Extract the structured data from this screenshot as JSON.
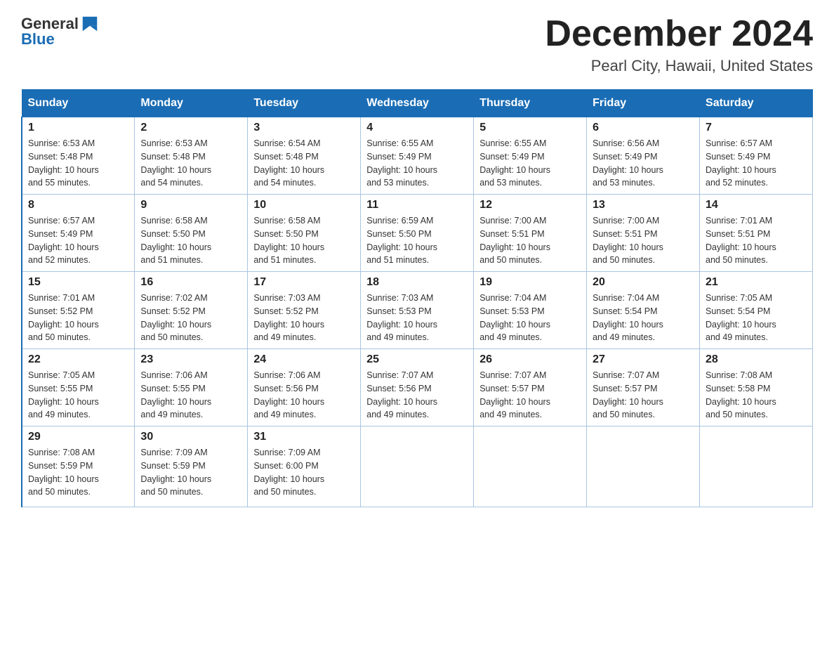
{
  "header": {
    "logo_general": "General",
    "logo_blue": "Blue",
    "month_title": "December 2024",
    "location": "Pearl City, Hawaii, United States"
  },
  "days_of_week": [
    "Sunday",
    "Monday",
    "Tuesday",
    "Wednesday",
    "Thursday",
    "Friday",
    "Saturday"
  ],
  "weeks": [
    [
      {
        "day": "1",
        "sunrise": "6:53 AM",
        "sunset": "5:48 PM",
        "daylight": "10 hours and 55 minutes."
      },
      {
        "day": "2",
        "sunrise": "6:53 AM",
        "sunset": "5:48 PM",
        "daylight": "10 hours and 54 minutes."
      },
      {
        "day": "3",
        "sunrise": "6:54 AM",
        "sunset": "5:48 PM",
        "daylight": "10 hours and 54 minutes."
      },
      {
        "day": "4",
        "sunrise": "6:55 AM",
        "sunset": "5:49 PM",
        "daylight": "10 hours and 53 minutes."
      },
      {
        "day": "5",
        "sunrise": "6:55 AM",
        "sunset": "5:49 PM",
        "daylight": "10 hours and 53 minutes."
      },
      {
        "day": "6",
        "sunrise": "6:56 AM",
        "sunset": "5:49 PM",
        "daylight": "10 hours and 53 minutes."
      },
      {
        "day": "7",
        "sunrise": "6:57 AM",
        "sunset": "5:49 PM",
        "daylight": "10 hours and 52 minutes."
      }
    ],
    [
      {
        "day": "8",
        "sunrise": "6:57 AM",
        "sunset": "5:49 PM",
        "daylight": "10 hours and 52 minutes."
      },
      {
        "day": "9",
        "sunrise": "6:58 AM",
        "sunset": "5:50 PM",
        "daylight": "10 hours and 51 minutes."
      },
      {
        "day": "10",
        "sunrise": "6:58 AM",
        "sunset": "5:50 PM",
        "daylight": "10 hours and 51 minutes."
      },
      {
        "day": "11",
        "sunrise": "6:59 AM",
        "sunset": "5:50 PM",
        "daylight": "10 hours and 51 minutes."
      },
      {
        "day": "12",
        "sunrise": "7:00 AM",
        "sunset": "5:51 PM",
        "daylight": "10 hours and 50 minutes."
      },
      {
        "day": "13",
        "sunrise": "7:00 AM",
        "sunset": "5:51 PM",
        "daylight": "10 hours and 50 minutes."
      },
      {
        "day": "14",
        "sunrise": "7:01 AM",
        "sunset": "5:51 PM",
        "daylight": "10 hours and 50 minutes."
      }
    ],
    [
      {
        "day": "15",
        "sunrise": "7:01 AM",
        "sunset": "5:52 PM",
        "daylight": "10 hours and 50 minutes."
      },
      {
        "day": "16",
        "sunrise": "7:02 AM",
        "sunset": "5:52 PM",
        "daylight": "10 hours and 50 minutes."
      },
      {
        "day": "17",
        "sunrise": "7:03 AM",
        "sunset": "5:52 PM",
        "daylight": "10 hours and 49 minutes."
      },
      {
        "day": "18",
        "sunrise": "7:03 AM",
        "sunset": "5:53 PM",
        "daylight": "10 hours and 49 minutes."
      },
      {
        "day": "19",
        "sunrise": "7:04 AM",
        "sunset": "5:53 PM",
        "daylight": "10 hours and 49 minutes."
      },
      {
        "day": "20",
        "sunrise": "7:04 AM",
        "sunset": "5:54 PM",
        "daylight": "10 hours and 49 minutes."
      },
      {
        "day": "21",
        "sunrise": "7:05 AM",
        "sunset": "5:54 PM",
        "daylight": "10 hours and 49 minutes."
      }
    ],
    [
      {
        "day": "22",
        "sunrise": "7:05 AM",
        "sunset": "5:55 PM",
        "daylight": "10 hours and 49 minutes."
      },
      {
        "day": "23",
        "sunrise": "7:06 AM",
        "sunset": "5:55 PM",
        "daylight": "10 hours and 49 minutes."
      },
      {
        "day": "24",
        "sunrise": "7:06 AM",
        "sunset": "5:56 PM",
        "daylight": "10 hours and 49 minutes."
      },
      {
        "day": "25",
        "sunrise": "7:07 AM",
        "sunset": "5:56 PM",
        "daylight": "10 hours and 49 minutes."
      },
      {
        "day": "26",
        "sunrise": "7:07 AM",
        "sunset": "5:57 PM",
        "daylight": "10 hours and 49 minutes."
      },
      {
        "day": "27",
        "sunrise": "7:07 AM",
        "sunset": "5:57 PM",
        "daylight": "10 hours and 50 minutes."
      },
      {
        "day": "28",
        "sunrise": "7:08 AM",
        "sunset": "5:58 PM",
        "daylight": "10 hours and 50 minutes."
      }
    ],
    [
      {
        "day": "29",
        "sunrise": "7:08 AM",
        "sunset": "5:59 PM",
        "daylight": "10 hours and 50 minutes."
      },
      {
        "day": "30",
        "sunrise": "7:09 AM",
        "sunset": "5:59 PM",
        "daylight": "10 hours and 50 minutes."
      },
      {
        "day": "31",
        "sunrise": "7:09 AM",
        "sunset": "6:00 PM",
        "daylight": "10 hours and 50 minutes."
      },
      null,
      null,
      null,
      null
    ]
  ],
  "labels": {
    "sunrise": "Sunrise:",
    "sunset": "Sunset:",
    "daylight": "Daylight:"
  }
}
